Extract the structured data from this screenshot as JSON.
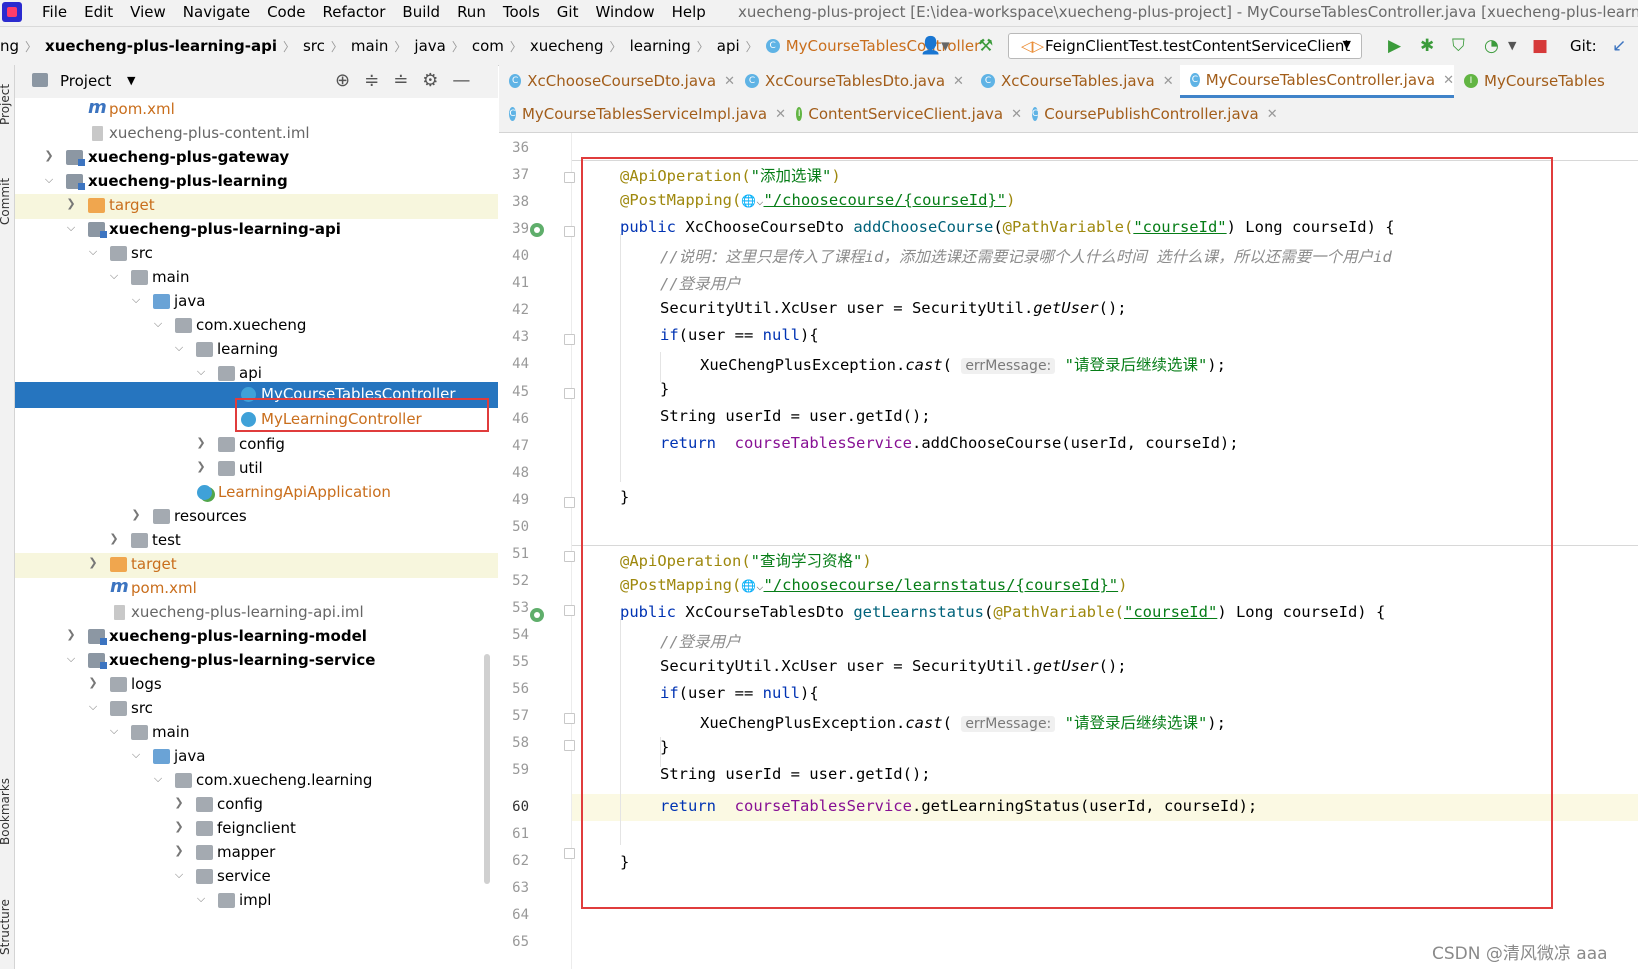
{
  "menu": {
    "items": [
      "File",
      "Edit",
      "View",
      "Navigate",
      "Code",
      "Refactor",
      "Build",
      "Run",
      "Tools",
      "Git",
      "Window",
      "Help"
    ],
    "window_title": "xuecheng-plus-project [E:\\idea-workspace\\xuecheng-plus-project] - MyCourseTablesController.java [xuecheng-plus-learning"
  },
  "nav": {
    "crumbs": [
      "ng",
      "xuecheng-plus-learning-api",
      "src",
      "main",
      "java",
      "com",
      "xuecheng",
      "learning",
      "api",
      "MyCourseTablesController"
    ],
    "run_config": "FeignClientTest.testContentServiceClient",
    "git_label": "Git:"
  },
  "stripe": {
    "project": "Project",
    "commit": "Commit",
    "bookmarks": "Bookmarks",
    "structure": "Structure"
  },
  "project_panel": {
    "title": "Project",
    "tree": [
      {
        "label": "pom.xml",
        "icon": "maven-icon"
      },
      {
        "label": "xuecheng-plus-content.iml",
        "icon": "iml-file-icon"
      },
      {
        "label": "xuecheng-plus-gateway",
        "icon": "module-folder-icon"
      },
      {
        "label": "xuecheng-plus-learning",
        "icon": "module-folder-icon"
      },
      {
        "label": "target",
        "icon": "excluded-folder-icon"
      },
      {
        "label": "xuecheng-plus-learning-api",
        "icon": "module-folder-icon"
      },
      {
        "label": "src",
        "icon": "folder-icon"
      },
      {
        "label": "main",
        "icon": "folder-icon"
      },
      {
        "label": "java",
        "icon": "source-folder-icon"
      },
      {
        "label": "com.xuecheng",
        "icon": "package-icon"
      },
      {
        "label": "learning",
        "icon": "package-icon"
      },
      {
        "label": "api",
        "icon": "package-icon"
      },
      {
        "label": "MyCourseTablesController",
        "icon": "java-class-icon"
      },
      {
        "label": "MyLearningController",
        "icon": "java-class-icon"
      },
      {
        "label": "config",
        "icon": "package-icon"
      },
      {
        "label": "util",
        "icon": "package-icon"
      },
      {
        "label": "LearningApiApplication",
        "icon": "spring-app-icon"
      },
      {
        "label": "resources",
        "icon": "resources-folder-icon"
      },
      {
        "label": "test",
        "icon": "folder-icon"
      },
      {
        "label": "target",
        "icon": "excluded-folder-icon"
      },
      {
        "label": "pom.xml",
        "icon": "maven-icon"
      },
      {
        "label": "xuecheng-plus-learning-api.iml",
        "icon": "iml-file-icon"
      },
      {
        "label": "xuecheng-plus-learning-model",
        "icon": "module-folder-icon"
      },
      {
        "label": "xuecheng-plus-learning-service",
        "icon": "module-folder-icon"
      },
      {
        "label": "logs",
        "icon": "folder-icon"
      },
      {
        "label": "src",
        "icon": "folder-icon"
      },
      {
        "label": "main",
        "icon": "folder-icon"
      },
      {
        "label": "java",
        "icon": "source-folder-icon"
      },
      {
        "label": "com.xuecheng.learning",
        "icon": "package-icon"
      },
      {
        "label": "config",
        "icon": "package-icon"
      },
      {
        "label": "feignclient",
        "icon": "package-icon"
      },
      {
        "label": "mapper",
        "icon": "package-icon"
      },
      {
        "label": "service",
        "icon": "package-icon"
      },
      {
        "label": "impl",
        "icon": "package-icon"
      }
    ]
  },
  "tabs_row1": [
    "XcChooseCourseDto.java",
    "XcCourseTablesDto.java",
    "XcCourseTables.java",
    "MyCourseTablesController.java",
    "MyCourseTables"
  ],
  "tabs_row2": [
    "MyCourseTablesServiceImpl.java",
    "ContentServiceClient.java",
    "CoursePublishController.java"
  ],
  "active_tab": "MyCourseTablesController.java",
  "editor": {
    "line_numbers": [
      "36",
      "37",
      "38",
      "39",
      "40",
      "41",
      "42",
      "43",
      "44",
      "45",
      "46",
      "47",
      "48",
      "49",
      "50",
      "51",
      "52",
      "53",
      "54",
      "55",
      "56",
      "57",
      "58",
      "59",
      "60",
      "61",
      "62",
      "63",
      "64",
      "65"
    ],
    "current_line": "60",
    "code": {
      "l37_ann": "@ApiOperation(",
      "l37_str": "\"添加选课\"",
      "l38_ann": "@PostMapping(",
      "l38_str": "\"/choosecourse/{courseId}\"",
      "l39_public": "public",
      "l39_type": "XcChooseCourseDto",
      "l39_method": "addChooseCourse",
      "l39_ann": "@PathVariable(",
      "l39_param": "\"courseId\"",
      "l39_tail": ") Long courseId) {",
      "l40_comment": "//说明：这里只是传入了课程id，添加选课还需要记录哪个人什么时间 选什么课，所以还需要一个用户id",
      "l41_comment": "//登录用户",
      "l42_a": "SecurityUtil.XcUser user = SecurityUtil.",
      "l42_b": "getUser",
      "l42_c": "();",
      "l43_if": "if",
      "l43_a": "(user == ",
      "l43_null": "null",
      "l43_b": "){",
      "l44_a": "XueChengPlusException.",
      "l44_cast": "cast",
      "l44_hint": "errMessage:",
      "l44_str": "\"请登录后继续选课\"",
      "l44_tail": ");",
      "close_brace": "}",
      "l46": "String userId = user.getId();",
      "l47_return": "return",
      "l47_field": "courseTablesService",
      "l47_tail": ".addChooseCourse(userId, courseId);",
      "l51_str": "\"查询学习资格\"",
      "l52_str": "\"/choosecourse/learnstatus/{courseId}\"",
      "l53_type": "XcCourseTablesDto",
      "l53_method": "getLearnstatus",
      "l60_tail": ".getLearningStatus(userId, courseId);"
    }
  },
  "watermark": "CSDN @清风微凉 aaa",
  "colors": {
    "selection": "#2675bf",
    "red_box": "#e03c3c",
    "keyword": "#0033b3",
    "string": "#067d17",
    "annotation": "#9e880d"
  }
}
